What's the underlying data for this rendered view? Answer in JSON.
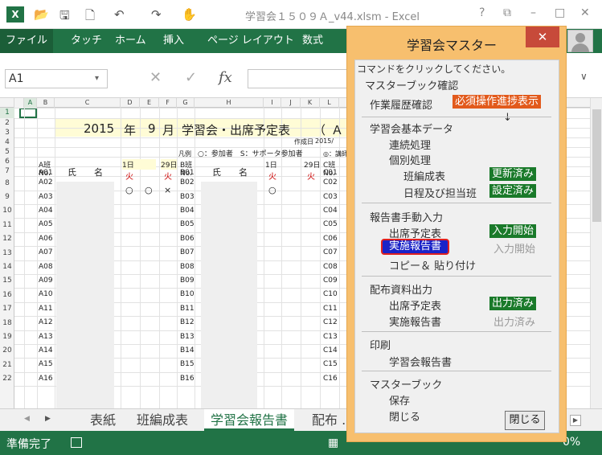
{
  "window": {
    "title": "学習会１５０９Ａ_v44.xlsm - Excel",
    "logo": "X",
    "help": "?",
    "restore": "⧉",
    "minimize": "–",
    "maximize": "□",
    "close": "✕"
  },
  "quick_access": {
    "open_icon": "📂",
    "save_icon": "🖫",
    "preview_icon": "🗋",
    "undo_icon": "↶",
    "redo_icon": "↷",
    "touch_icon": "✋"
  },
  "ribbon": {
    "file": "ファイル",
    "tabs": [
      "タッチ",
      "ホーム",
      "挿入",
      "ページ レイアウト",
      "数式"
    ]
  },
  "formula_bar": {
    "namebox": "A1",
    "namebox_arrow": "▾",
    "cancel": "✕",
    "enter": "✓",
    "fx": "fx",
    "expand": "∨"
  },
  "sheet": {
    "columns": [
      "A",
      "B",
      "C",
      "D",
      "E",
      "F",
      "G",
      "H",
      "I",
      "J",
      "K",
      "L"
    ],
    "rows": [
      "1",
      "2",
      "3",
      "4",
      "5",
      "6",
      "7",
      "8",
      "9",
      "10",
      "11",
      "12",
      "13",
      "14",
      "15",
      "16",
      "17",
      "18",
      "19",
      "20",
      "21",
      "22"
    ],
    "title_year": "2015",
    "title_nen": "年",
    "title_month": "9",
    "title_tsuki": "月",
    "title_text": "学習会・出席予定表",
    "title_paren": "（",
    "title_a": "Ａ",
    "created_label": "作成日",
    "created_value": "2015/",
    "legend_label": "凡例",
    "legend_text": "○：参加者　S：サポータ参加者",
    "legend_extra": "◎：講師",
    "group_a": "A班",
    "group_b": "B班",
    "group_c": "C班",
    "no_label": "No.",
    "name_header": "氏　　名",
    "day1": "1日",
    "day29": "29日",
    "tue": "火",
    "a_ids": [
      "A01",
      "A02",
      "A03",
      "A04",
      "A05",
      "A06",
      "A07",
      "A08",
      "A09",
      "A10",
      "A11",
      "A12",
      "A13",
      "A14",
      "A15",
      "A16"
    ],
    "b_ids": [
      "B01",
      "B02",
      "B03",
      "B04",
      "B05",
      "B06",
      "B07",
      "B08",
      "B09",
      "B10",
      "B11",
      "B12",
      "B13",
      "B14",
      "B15",
      "B16"
    ],
    "c_ids": [
      "C01",
      "C02",
      "C03",
      "C04",
      "C05",
      "C06",
      "C07",
      "C08",
      "C09",
      "C10",
      "C11",
      "C12",
      "C13",
      "C14",
      "C15",
      "C16"
    ],
    "a01_marks": [
      "○",
      "○",
      "×"
    ],
    "b01_mark": "○"
  },
  "sheet_tabs": {
    "nav_left": "◀",
    "nav_right": "▶",
    "tabs": [
      "表紙",
      "班編成表",
      "学習会報告書",
      "配布 ..."
    ],
    "active_index": 2,
    "scroll_right": "▶"
  },
  "statusbar": {
    "text": "準備完了",
    "grid_icon": "▦",
    "zoom": "0%"
  },
  "dialog": {
    "title": "学習会マスター",
    "close": "✕",
    "instruction": "コマンドをクリックしてください。",
    "master_check": "マスターブック確認",
    "work_history": "作業履歴確認",
    "required_badge": "必須操作進捗表示",
    "down_arrow": "↓",
    "basic_data": "学習会基本データ",
    "continuous": "連続処理",
    "individual": "個別処理",
    "group_table": "班編成表",
    "group_table_status": "更新済み",
    "schedule": "日程及び担当班",
    "schedule_status": "設定済み",
    "report_input": "報告書手動入力",
    "attendance_plan": "出席予定表",
    "attendance_plan_status": "入力開始",
    "report": "実施報告書",
    "report_status": "入力開始",
    "copy_paste": "コピー＆ 貼り付け",
    "handout": "配布資料出力",
    "handout_plan": "出席予定表",
    "handout_plan_status": "出力済み",
    "handout_report": "実施報告書",
    "handout_report_status": "出力済み",
    "print": "印刷",
    "print_report": "学習会報告書",
    "master_book": "マスターブック",
    "save": "保存",
    "close_book": "閉じる",
    "close_button": "閉じる"
  }
}
